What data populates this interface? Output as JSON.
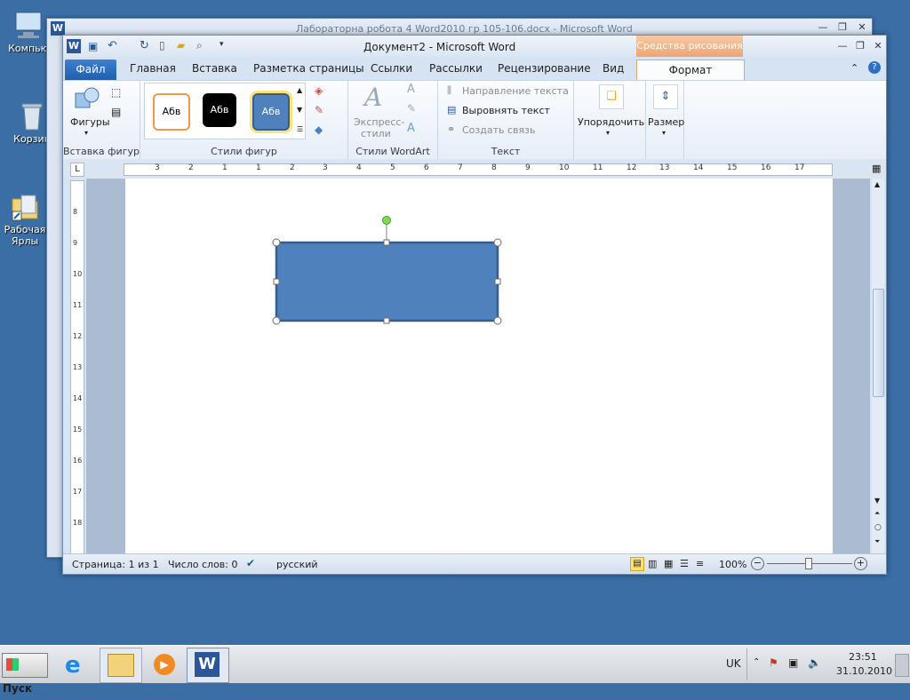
{
  "desktop": {
    "icons": [
      {
        "label": "Компью"
      },
      {
        "label": "Корзин"
      },
      {
        "label": "Рабочая Ярлы"
      }
    ]
  },
  "back_window": {
    "title": "Лабораторна робота 4 Word2010 гр  105-106.docx  -  Microsoft Word"
  },
  "window": {
    "title": "Документ2  -  Microsoft Word",
    "context_header": "Средства рисования",
    "tabs": [
      "Главная",
      "Вставка",
      "Разметка страницы",
      "Ссылки",
      "Рассылки",
      "Рецензирование",
      "Вид"
    ],
    "file_tab": "Файл",
    "format_tab": "Формат"
  },
  "ribbon": {
    "insert_shapes": {
      "shapes_label": "Фигуры",
      "group_label": "Вставка фигур"
    },
    "shape_styles": {
      "previews": [
        "Абв",
        "Абв",
        "Абв"
      ],
      "group_label": "Стили фигур"
    },
    "wordart": {
      "express_label": "Экспресс-",
      "styles_label": "стили",
      "group_label": "Стили WordArt"
    },
    "text": {
      "direction": "Направление текста",
      "align": "Выровнять текст",
      "link": "Создать связь",
      "group_label": "Текст"
    },
    "arrange": {
      "label": "Упорядочить"
    },
    "size": {
      "label": "Размер"
    }
  },
  "ruler": {
    "h_ticks": [
      "3",
      "2",
      "1",
      "1",
      "2",
      "3",
      "4",
      "5",
      "6",
      "7",
      "8",
      "9",
      "10",
      "11",
      "12",
      "13",
      "14",
      "15",
      "16",
      "17"
    ],
    "v_ticks": [
      "8",
      "9",
      "10",
      "11",
      "12",
      "13",
      "14",
      "15",
      "16",
      "17",
      "18"
    ]
  },
  "statusbar": {
    "page": "Страница: 1 из 1",
    "words": "Число слов: 0",
    "language": "русский",
    "zoom": "100%"
  },
  "taskbar": {
    "start": "Пуск",
    "lang": "UK",
    "time": "23:51",
    "date": "31.10.2010"
  },
  "colors": {
    "shape_fill": "#4f81bd",
    "shape_border": "#385d8a",
    "desktop": "#3a6ea5",
    "context_tab": "#eea674"
  }
}
